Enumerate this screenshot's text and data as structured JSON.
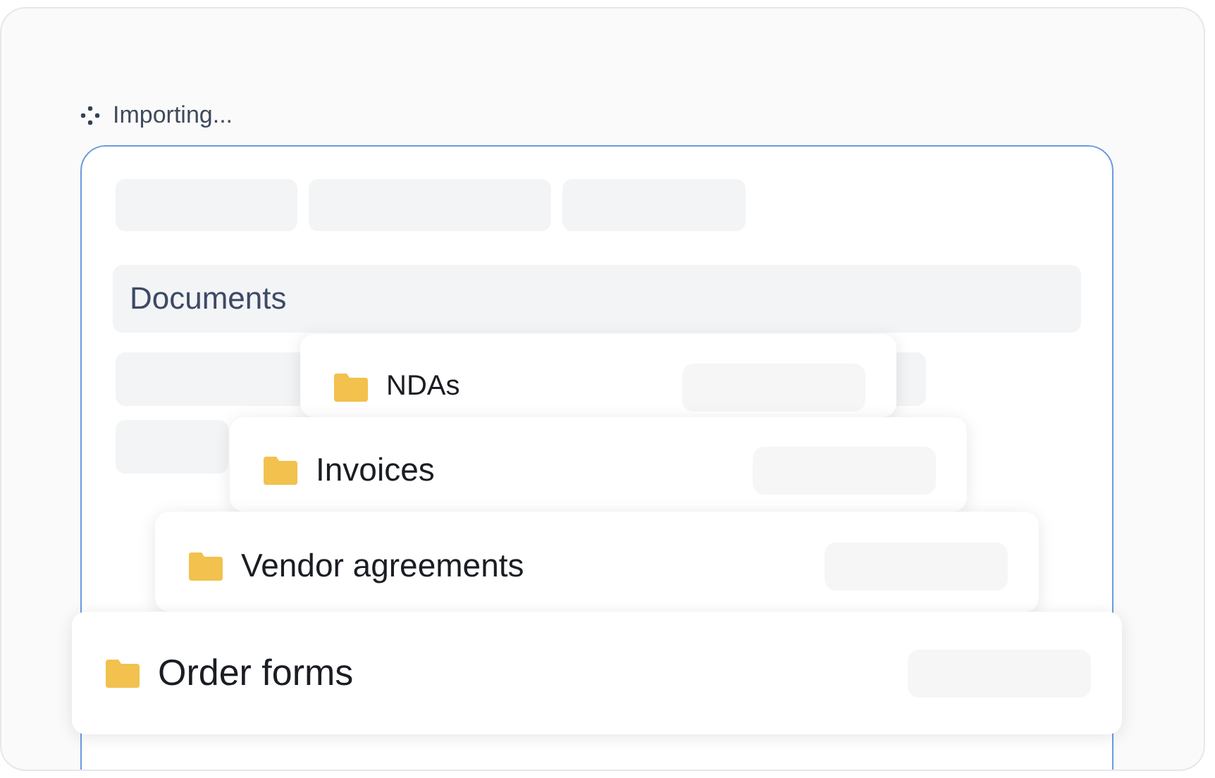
{
  "status": {
    "text": "Importing..."
  },
  "section": {
    "title": "Documents"
  },
  "folders": [
    {
      "name": "NDAs"
    },
    {
      "name": "Invoices"
    },
    {
      "name": "Vendor agreements"
    },
    {
      "name": "Order forms"
    }
  ]
}
